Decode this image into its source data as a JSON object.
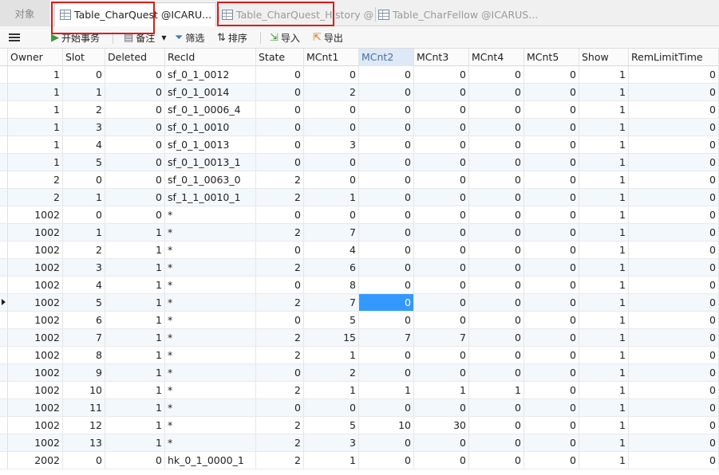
{
  "tabs": {
    "objects": "对象",
    "active": "Table_CharQuest @ICARU...",
    "history": "Table_CharQuest_History @...",
    "fellow": "Table_CharFellow @ICARUS..."
  },
  "toolbar": {
    "begin_transaction": "开始事务",
    "note": "备注",
    "filter": "筛选",
    "sort": "排序",
    "import": "导入",
    "export": "导出"
  },
  "columns": [
    "Owner",
    "Slot",
    "Deleted",
    "RecId",
    "State",
    "MCnt1",
    "MCnt2",
    "MCnt3",
    "MCnt4",
    "MCnt5",
    "Show",
    "RemLimitTime"
  ],
  "rows": [
    [
      "1",
      "0",
      "0",
      "sf_0_1_0012",
      "0",
      "0",
      "0",
      "0",
      "0",
      "0",
      "1",
      "0"
    ],
    [
      "1",
      "1",
      "0",
      "sf_0_1_0014",
      "0",
      "2",
      "0",
      "0",
      "0",
      "0",
      "1",
      "0"
    ],
    [
      "1",
      "2",
      "0",
      "sf_0_1_0006_4",
      "0",
      "0",
      "0",
      "0",
      "0",
      "0",
      "1",
      "0"
    ],
    [
      "1",
      "3",
      "0",
      "sf_0_1_0010",
      "0",
      "0",
      "0",
      "0",
      "0",
      "0",
      "1",
      "0"
    ],
    [
      "1",
      "4",
      "0",
      "sf_0_1_0013",
      "0",
      "3",
      "0",
      "0",
      "0",
      "0",
      "1",
      "0"
    ],
    [
      "1",
      "5",
      "0",
      "sf_0_1_0013_1",
      "0",
      "0",
      "0",
      "0",
      "0",
      "0",
      "1",
      "0"
    ],
    [
      "2",
      "0",
      "0",
      "sf_0_1_0063_0",
      "2",
      "0",
      "0",
      "0",
      "0",
      "0",
      "1",
      "0"
    ],
    [
      "2",
      "1",
      "0",
      "sf_1_1_0010_1",
      "2",
      "1",
      "0",
      "0",
      "0",
      "0",
      "1",
      "0"
    ],
    [
      "1002",
      "0",
      "0",
      "*",
      "0",
      "0",
      "0",
      "0",
      "0",
      "0",
      "1",
      "0"
    ],
    [
      "1002",
      "1",
      "1",
      "*",
      "2",
      "7",
      "0",
      "0",
      "0",
      "0",
      "1",
      "0"
    ],
    [
      "1002",
      "2",
      "1",
      "*",
      "0",
      "4",
      "0",
      "0",
      "0",
      "0",
      "1",
      "0"
    ],
    [
      "1002",
      "3",
      "1",
      "*",
      "2",
      "6",
      "0",
      "0",
      "0",
      "0",
      "1",
      "0"
    ],
    [
      "1002",
      "4",
      "1",
      "*",
      "0",
      "8",
      "0",
      "0",
      "0",
      "0",
      "1",
      "0"
    ],
    [
      "1002",
      "5",
      "1",
      "*",
      "2",
      "7",
      "0",
      "0",
      "0",
      "0",
      "1",
      "0"
    ],
    [
      "1002",
      "6",
      "1",
      "*",
      "0",
      "5",
      "0",
      "0",
      "0",
      "0",
      "1",
      "0"
    ],
    [
      "1002",
      "7",
      "1",
      "*",
      "2",
      "15",
      "7",
      "7",
      "0",
      "0",
      "1",
      "0"
    ],
    [
      "1002",
      "8",
      "1",
      "*",
      "2",
      "1",
      "0",
      "0",
      "0",
      "0",
      "1",
      "0"
    ],
    [
      "1002",
      "9",
      "1",
      "*",
      "0",
      "2",
      "0",
      "0",
      "0",
      "0",
      "1",
      "0"
    ],
    [
      "1002",
      "10",
      "1",
      "*",
      "2",
      "1",
      "1",
      "1",
      "1",
      "0",
      "1",
      "0"
    ],
    [
      "1002",
      "11",
      "1",
      "*",
      "0",
      "0",
      "0",
      "0",
      "0",
      "0",
      "1",
      "0"
    ],
    [
      "1002",
      "12",
      "1",
      "*",
      "2",
      "5",
      "10",
      "30",
      "0",
      "0",
      "1",
      "0"
    ],
    [
      "1002",
      "13",
      "1",
      "*",
      "2",
      "3",
      "0",
      "0",
      "0",
      "0",
      "1",
      "0"
    ],
    [
      "2002",
      "0",
      "0",
      "hk_0_1_0000_1",
      "2",
      "1",
      "0",
      "0",
      "0",
      "0",
      "1",
      "0"
    ]
  ],
  "selected_column": "MCnt2",
  "current_row_index": 13,
  "colors": {
    "selection": "#3399ff",
    "highlight_box": "#e0191b",
    "alt_row": "#f3f8fd"
  }
}
